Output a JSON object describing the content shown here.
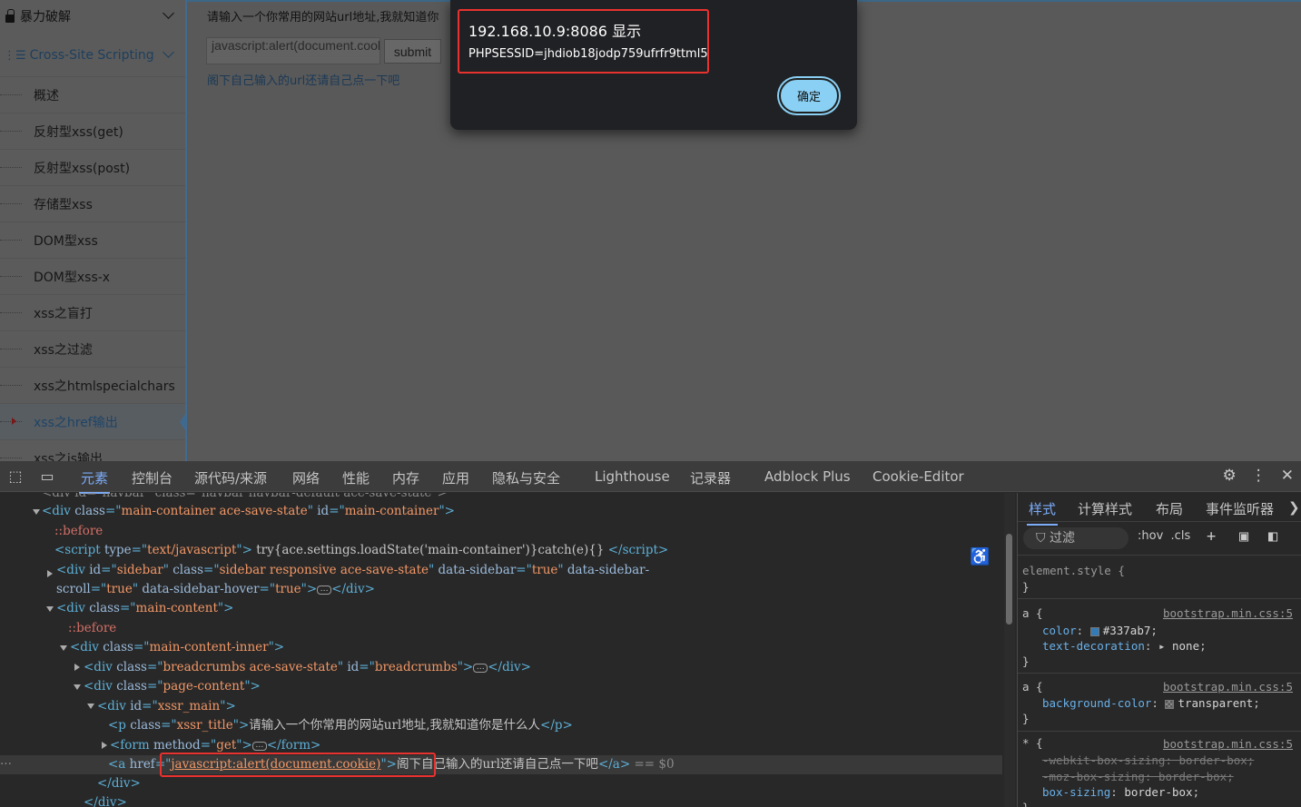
{
  "sidebar": {
    "section1": "暴力破解",
    "section2": "Cross-Site Scripting",
    "items": [
      "概述",
      "反射型xss(get)",
      "反射型xss(post)",
      "存储型xss",
      "DOM型xss",
      "DOM型xss-x",
      "xss之盲打",
      "xss之过滤",
      "xss之htmlspecialchars",
      "xss之href输出",
      "xss之js输出"
    ],
    "active_index": 9
  },
  "content": {
    "title": "请输入一个你常用的网站url地址,我就知道你",
    "input_value": "javascript:alert(document.cookie)",
    "submit_label": "submit",
    "link_text": "阁下自己输入的url还请自己点一下吧"
  },
  "alert": {
    "title": "192.168.10.9:8086 显示",
    "message": "PHPSESSID=jhdiob18jodp759ufrfr9ttml5",
    "ok_label": "确定"
  },
  "devtools": {
    "tabs": [
      "元素",
      "控制台",
      "源代码/来源",
      "网络",
      "性能",
      "内存",
      "应用",
      "隐私与安全",
      "Lighthouse",
      "记录器",
      "Adblock Plus",
      "Cookie-Editor"
    ],
    "active_tab": "元素",
    "icons": [
      "inspect-icon",
      "device-toggle-icon",
      "gear-icon",
      "kebab-menu-icon",
      "close-icon"
    ],
    "accent_color": "#7cacf8"
  },
  "dom": {
    "line0": "<div id=\"navbar\" class=\"navbar navbar-default    ace-save-state\">",
    "l1_tag": "div",
    "l1_attr1": "class",
    "l1_val1": "main-container ace-save-state",
    "l1_attr2": "id",
    "l1_val2": "main-container",
    "l2": "::before",
    "l3_attr": "type",
    "l3_val": "text/javascript",
    "l3_text": "try{ace.settings.loadState('main-container')}catch(e){}",
    "l4_attr1": "id",
    "l4_val1": "sidebar",
    "l4_attr2": "class",
    "l4_val2": "sidebar                    responsive                       ace-save-state",
    "l4_attr3": "data-sidebar",
    "l4_val3": "true",
    "l4_attr4": "data-sidebar-",
    "l5_prefix": "scroll",
    "l5_val1": "true",
    "l5_attr2": "data-sidebar-hover",
    "l5_val2": "true",
    "l6_val": "main-content",
    "l7": "::before",
    "l8_val": "main-content-inner",
    "l9_val1": "breadcrumbs ace-save-state",
    "l9_val2": "breadcrumbs",
    "l10_val": "page-content",
    "l11_val": "xssr_main",
    "l12_val": "xssr_title",
    "l12_text": "请输入一个你常用的网站url地址,我就知道你是什么人",
    "l13_val": "get",
    "l14_href": "javascript:alert(document.cookie)",
    "l14_text": "阁下自己输入的url还请自己点一下吧",
    "l14_suffix": "== $0"
  },
  "styles": {
    "tabs": [
      "样式",
      "计算样式",
      "布局",
      "事件监听器"
    ],
    "filter_placeholder": "过滤",
    "hov": ":hov",
    "cls": ".cls",
    "element_style": "element.style {",
    "rule1_selector": "a {",
    "rule1_source": "bootstrap.min.css:5",
    "rule1_prop1": "color",
    "rule1_val1": "#337ab7",
    "rule1_prop2": "text-decoration",
    "rule1_val2": "none",
    "rule2_selector": "a {",
    "rule2_source": "bootstrap.min.css:5",
    "rule2_prop1": "background-color",
    "rule2_val1": "transparent",
    "rule3_selector": "* {",
    "rule3_source": "bootstrap.min.css:5",
    "rule3_prop1": "-webkit-box-sizing",
    "rule3_val1": "border-box",
    "rule3_prop2": "-moz-box-sizing",
    "rule3_val2": "border-box",
    "rule3_prop3": "box-sizing",
    "rule3_val3": "border-box"
  }
}
